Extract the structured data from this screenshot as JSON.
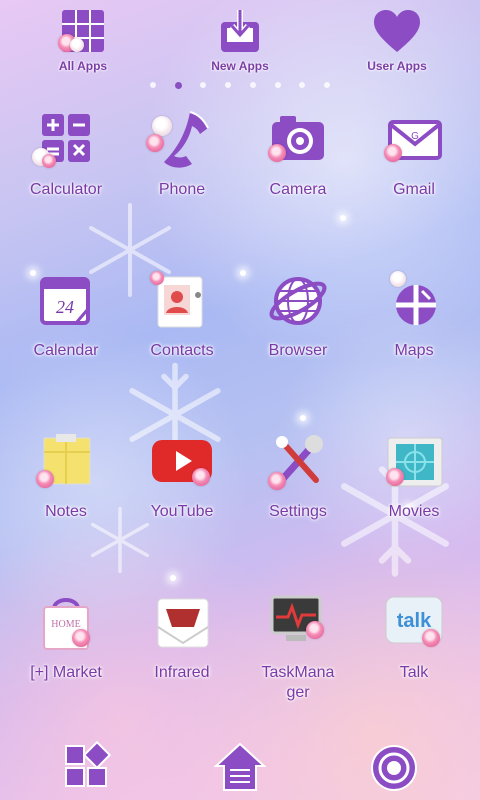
{
  "top_bar": {
    "all_apps": "All Apps",
    "new_apps": "New Apps",
    "user_apps": "User Apps"
  },
  "page_indicator": {
    "count": 8,
    "active": 1
  },
  "apps": [
    {
      "label": "Calculator",
      "icon": "calculator-icon"
    },
    {
      "label": "Phone",
      "icon": "phone-icon"
    },
    {
      "label": "Camera",
      "icon": "camera-icon"
    },
    {
      "label": "Gmail",
      "icon": "gmail-icon"
    },
    {
      "label": "Calendar",
      "icon": "calendar-icon",
      "icon_text": "24"
    },
    {
      "label": "Contacts",
      "icon": "contacts-icon"
    },
    {
      "label": "Browser",
      "icon": "browser-icon"
    },
    {
      "label": "Maps",
      "icon": "maps-icon"
    },
    {
      "label": "Notes",
      "icon": "notes-icon"
    },
    {
      "label": "YouTube",
      "icon": "youtube-icon"
    },
    {
      "label": "Settings",
      "icon": "settings-icon"
    },
    {
      "label": "Movies",
      "icon": "movies-icon"
    },
    {
      "label": "[+] Market",
      "icon": "market-icon",
      "icon_text": "HOME"
    },
    {
      "label": "Infrared",
      "icon": "infrared-icon"
    },
    {
      "label": "TaskMana ger",
      "icon": "task-manager-icon"
    },
    {
      "label": "Talk",
      "icon": "talk-icon",
      "icon_text": "talk"
    }
  ],
  "dock": {
    "left": "apps-grid-icon",
    "center": "home-icon",
    "right": "settings-gear-icon"
  },
  "colors": {
    "accent_purple": "#7a3aa8",
    "icon_purple": "#8b4cc4",
    "youtube_red": "#e02a2a",
    "talk_blue": "#3d8fd6"
  }
}
